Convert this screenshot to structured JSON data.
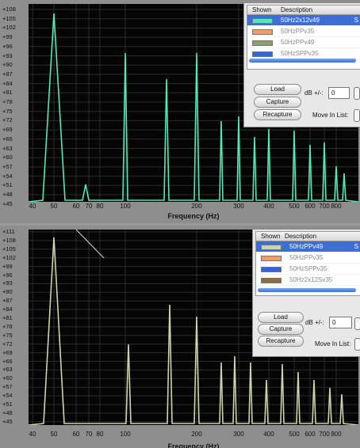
{
  "colors": {
    "trace_top": "#55e8b4",
    "trace_bottom": "#c9d6a8",
    "selection": "#3b6fd6",
    "plot_bg": "#050505"
  },
  "y_axis_labels": [
    "+111",
    "+108",
    "+105",
    "+102",
    "+99",
    "+96",
    "+93",
    "+90",
    "+87",
    "+84",
    "+81",
    "+78",
    "+75",
    "+72",
    "+69",
    "+66",
    "+63",
    "+60",
    "+57",
    "+54",
    "+51",
    "+48",
    "+45"
  ],
  "x_axis_title": "Frequency (Hz)",
  "top": {
    "y_labels": [
      "+108",
      "+105",
      "+102",
      "+99",
      "+96",
      "+93",
      "+90",
      "+87",
      "+84",
      "+81",
      "+78",
      "+75",
      "+72",
      "+69",
      "+66",
      "+63",
      "+60",
      "+57",
      "+54",
      "+51",
      "+48",
      "+45"
    ],
    "x_ticks": [
      "40",
      "50",
      "60",
      "70",
      "80",
      "100",
      "200",
      "300",
      "400",
      "500",
      "600",
      "700",
      "800"
    ],
    "panel": {
      "header_shown": "Shown",
      "header_description": "Description",
      "items": [
        {
          "label": "50Hz2x12v49",
          "color": "#55e8b4",
          "selected": true
        },
        {
          "label": "50HzPPv35",
          "color": "#e8a070",
          "selected": false
        },
        {
          "label": "50HzPPv49",
          "color": "#8c9c6c",
          "selected": false
        },
        {
          "label": "50HzSPPv35",
          "color": "#3a63d2",
          "selected": false
        }
      ],
      "cut_text": "S",
      "load": "Load",
      "capture": "Capture",
      "recapture": "Recapture",
      "db_label": "dB +/-:",
      "db_value": "0",
      "move_label": "Move In List:"
    }
  },
  "bottom": {
    "y_labels": [
      "+111",
      "+108",
      "+105",
      "+102",
      "+99",
      "+96",
      "+93",
      "+90",
      "+87",
      "+84",
      "+81",
      "+78",
      "+75",
      "+72",
      "+69",
      "+66",
      "+63",
      "+60",
      "+57",
      "+54",
      "+51",
      "+48",
      "+45"
    ],
    "x_ticks": [
      "40",
      "50",
      "60",
      "70",
      "80",
      "100",
      "200",
      "300",
      "400",
      "500",
      "600",
      "700",
      "800"
    ],
    "panel": {
      "header_shown": "Shown",
      "header_description": "Description",
      "items": [
        {
          "label": "50HzPPv49",
          "color": "#c9d6a8",
          "selected": true
        },
        {
          "label": "50HzPPv35",
          "color": "#e8a070",
          "selected": false
        },
        {
          "label": "50HzSPPv35",
          "color": "#3a63d2",
          "selected": false
        },
        {
          "label": "50Hz2x12Sv35",
          "color": "#8c6c44",
          "selected": false
        }
      ],
      "cut_text": "S",
      "load": "Load",
      "capture": "Capture",
      "recapture": "Recapture",
      "db_label": "dB +/-:",
      "db_value": "0",
      "move_label": "Move In List:"
    }
  }
}
